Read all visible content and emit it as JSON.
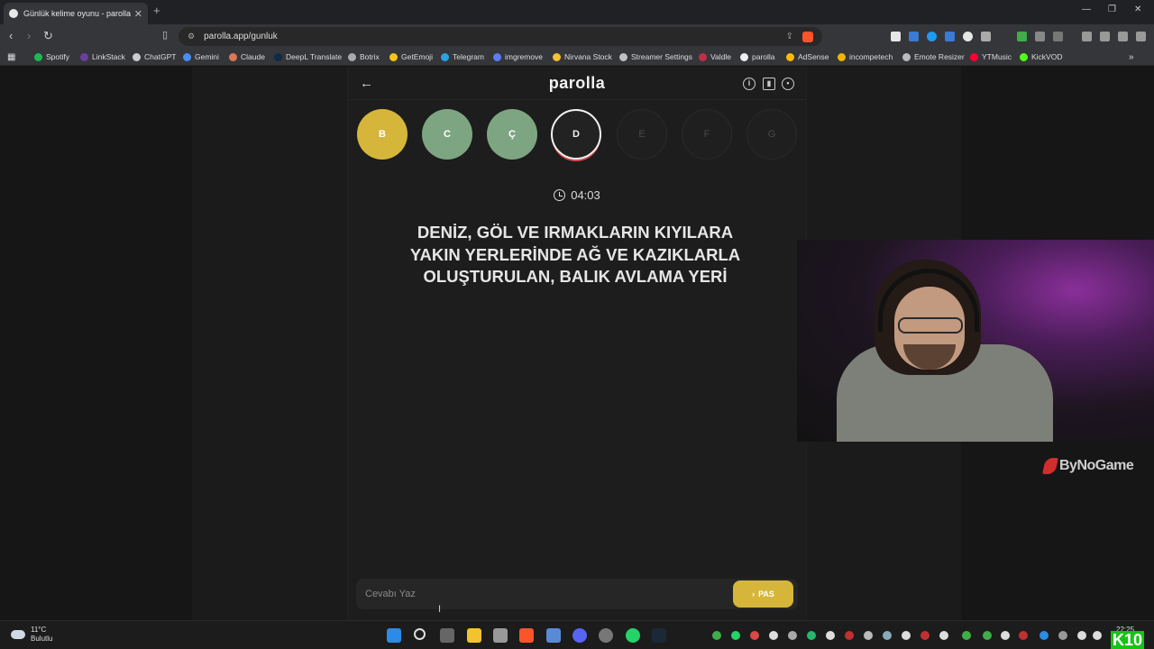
{
  "browser": {
    "tab_title": "Günlük kelime oyunu - parolla -",
    "tab_close": "✕",
    "new_tab": "+",
    "url": "parolla.app/gunluk",
    "bookmarks": [
      "Spotify",
      "LinkStack",
      "ChatGPT",
      "Gemini",
      "Claude",
      "DeepL Translate",
      "Botrix",
      "GetEmoji",
      "Telegram",
      "imgremove",
      "Nirvana Stock",
      "Streamer Settings",
      "Valdle",
      "parolla",
      "AdSense",
      "incompetech",
      "Emote Resizer",
      "YTMusic",
      "KickVOD"
    ],
    "bookmark_colors": [
      "#1db954",
      "#6b3fa0",
      "#cccccc",
      "#4a8df6",
      "#d97757",
      "#0f2b46",
      "#aaaaaa",
      "#f5c518",
      "#2aa3df",
      "#5a7df0",
      "#f2c230",
      "#c0c0c0",
      "#c0304a",
      "#eeeeee",
      "#fbbc04",
      "#f0b400",
      "#bbbbbb",
      "#ff0033",
      "#53fc18"
    ]
  },
  "game": {
    "brand": "parolla",
    "back_icon": "←",
    "letters": [
      {
        "letter": "B",
        "state": "correct-yellow"
      },
      {
        "letter": "C",
        "state": "correct-green"
      },
      {
        "letter": "Ç",
        "state": "correct-green"
      },
      {
        "letter": "D",
        "state": "active"
      },
      {
        "letter": "E",
        "state": "upcoming"
      },
      {
        "letter": "F",
        "state": "upcoming"
      },
      {
        "letter": "G",
        "state": "upcoming"
      }
    ],
    "timer": "04:03",
    "question_lines": [
      "DENİZ, GÖL VE IRMAKLARIN KIYILARA",
      "YAKIN YERLERİNDE AĞ VE KAZIKLARLA",
      "OLUŞTURULAN, BALIK AVLAMA YERİ"
    ],
    "answer_placeholder": "Cevabı Yaz",
    "pass_label": "PAS",
    "colors": {
      "yellow": "#d6b63a",
      "green": "#7ea581",
      "active_ring": "#f2f2f2",
      "active_accent": "#d94848"
    }
  },
  "overlay": {
    "sponsor": "ByNoGame",
    "badge": "10"
  },
  "taskbar": {
    "weather_temp": "11°C",
    "weather_desc": "Bulutlu",
    "time": "22:25"
  }
}
